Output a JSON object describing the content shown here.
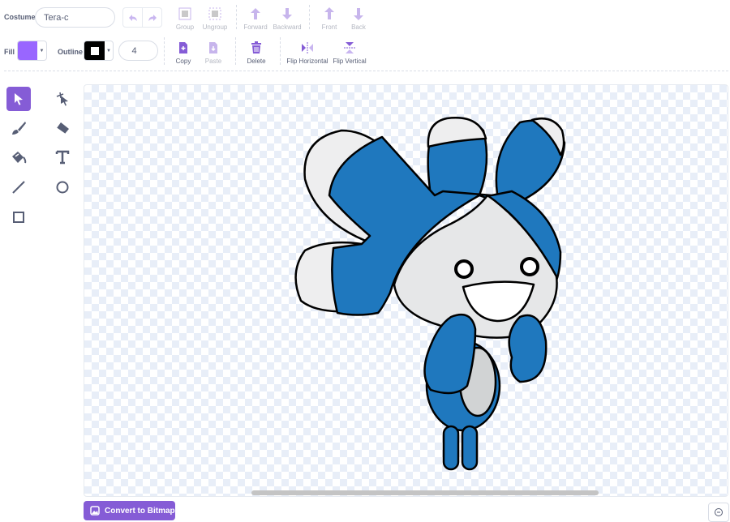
{
  "costume": {
    "label": "Costume",
    "name": "Tera-c"
  },
  "fill": {
    "label": "Fill",
    "color": "#9966ff"
  },
  "outline": {
    "label": "Outline",
    "color": "#000000",
    "width": "4"
  },
  "toolbar": {
    "group": "Group",
    "ungroup": "Ungroup",
    "forward": "Forward",
    "backward": "Backward",
    "front": "Front",
    "back": "Back",
    "copy": "Copy",
    "paste": "Paste",
    "delete": "Delete",
    "flip_horizontal": "Flip Horizontal",
    "flip_vertical": "Flip Vertical"
  },
  "tools": [
    "select",
    "reshape",
    "brush",
    "eraser",
    "fill",
    "text",
    "line",
    "circle",
    "rectangle"
  ],
  "selected_tool": "select",
  "convert_button": "Convert to Bitmap",
  "colors": {
    "accent": "#855cd6",
    "hair_blue": "#1f78be",
    "face_gray": "#e6e7e8"
  }
}
